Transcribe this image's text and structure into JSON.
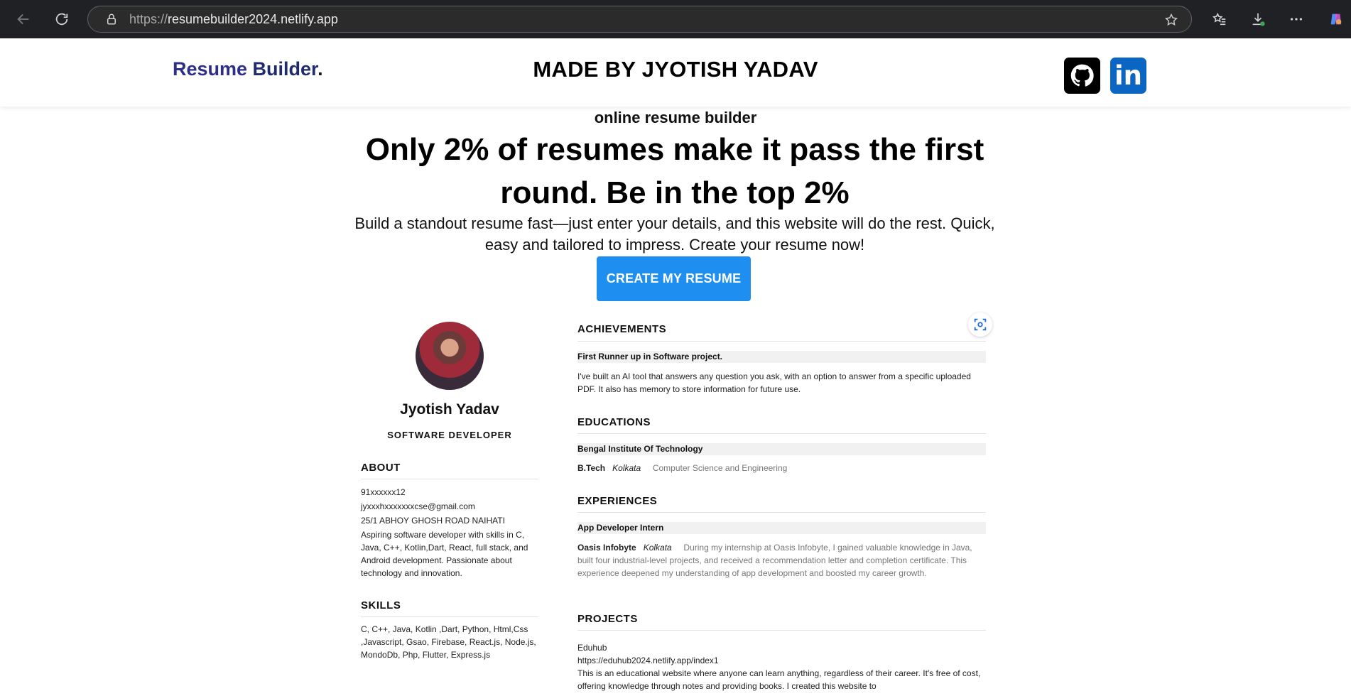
{
  "browser": {
    "url_protocol": "https://",
    "url_host": "resumebuilder2024.netlify.app"
  },
  "header": {
    "logo_word1": "Resume",
    "logo_word2": " Builder",
    "logo_dot": ".",
    "made_by": "MADE BY JYOTISH YADAV",
    "linkedin_text": "in"
  },
  "hero": {
    "eyebrow": "online resume builder",
    "headline": "Only 2% of resumes make it pass the first round. Be in the top 2%",
    "subtext": "Build a standout resume fast—just enter your details, and this website will do the rest. Quick, easy and tailored to impress. Create your resume now!",
    "cta": "CREATE MY RESUME"
  },
  "resume": {
    "name": "Jyotish Yadav",
    "role": "SOFTWARE DEVELOPER",
    "about_title": "ABOUT",
    "phone": "91xxxxxx12",
    "email": "jyxxxhxxxxxxxcse@gmail.com",
    "address": "25/1 ABHOY GHOSH ROAD NAIHATI",
    "about_text": "Aspiring software developer with skills in C, Java, C++, Kotlin,Dart, React, full stack, and Android development. Passionate about technology and innovation.",
    "skills_title": "SKILLS",
    "skills_text": "C, C++, Java, Kotlin ,Dart, Python, Html,Css ,Javascript, Gsao, Firebase, React.js, Node.js, MondoDb, Php, Flutter, Express.js",
    "achievements_title": "ACHIEVEMENTS",
    "achievement_head": "First Runner up in Software project.",
    "achievement_text": "I've built an AI tool that answers any question you ask, with an option to answer from a specific uploaded PDF. It also has memory to store information for future use.",
    "educations_title": "EDUCATIONS",
    "edu_head": "Bengal Institute Of Technology",
    "edu_degree": "B.Tech",
    "edu_city": "Kolkata",
    "edu_field": "Computer Science and Engineering",
    "experiences_title": "EXPERIENCES",
    "exp_head": "App Developer Intern",
    "exp_company": "Oasis Infobyte",
    "exp_city": "Kolkata",
    "exp_text": "During my internship at Oasis Infobyte, I gained valuable knowledge in Java, built four industrial-level projects, and received a recommendation letter and completion certificate. This experience deepened my understanding of app development and boosted my career growth.",
    "projects_title": "PROJECTS",
    "proj_name": "Eduhub",
    "proj_url": "https://eduhub2024.netlify.app/index1",
    "proj_text": "This is an educational website where anyone can learn anything, regardless of their career. It's free of cost, offering knowledge through notes and providing books. I created this website to"
  }
}
